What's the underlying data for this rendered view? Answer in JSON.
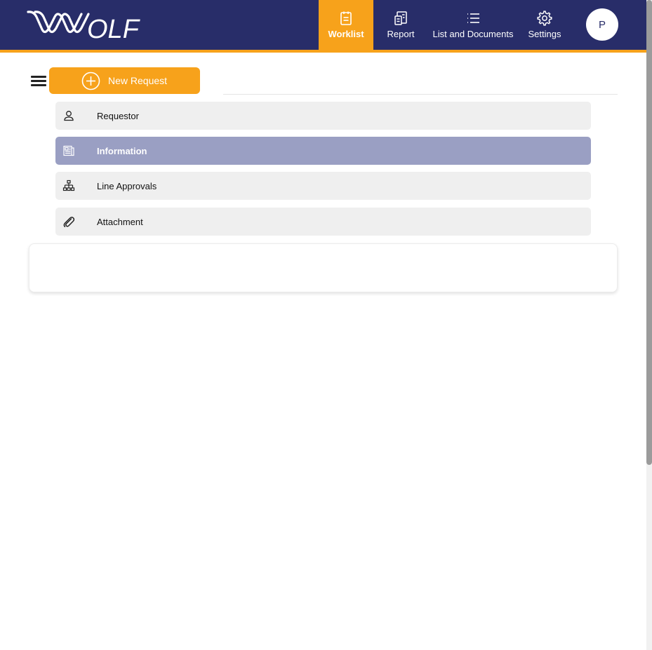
{
  "brand": {
    "logo_text": "WOLF",
    "colors": {
      "header_bg": "#282d69",
      "accent": "#f7a21b",
      "active_step": "#9a9fc3",
      "step_bg": "#efefef"
    }
  },
  "nav": {
    "items": [
      {
        "label": "Worklist",
        "icon": "clipboard-icon",
        "active": true
      },
      {
        "label": "Report",
        "icon": "report-icon",
        "active": false
      },
      {
        "label": "List and Documents",
        "icon": "list-icon",
        "active": false
      },
      {
        "label": "Settings",
        "icon": "gear-icon",
        "active": false
      }
    ],
    "avatar_initial": "P"
  },
  "toolbar": {
    "menu_icon": "hamburger-icon",
    "new_request_label": "New Request",
    "new_request_icon": "plus-circle-icon"
  },
  "steps": [
    {
      "label": "Requestor",
      "icon": "user-icon",
      "active": false
    },
    {
      "label": "Information",
      "icon": "document-icon",
      "active": true
    },
    {
      "label": "Line Approvals",
      "icon": "org-chart-icon",
      "active": false
    },
    {
      "label": "Attachment",
      "icon": "paperclip-icon",
      "active": false
    }
  ]
}
